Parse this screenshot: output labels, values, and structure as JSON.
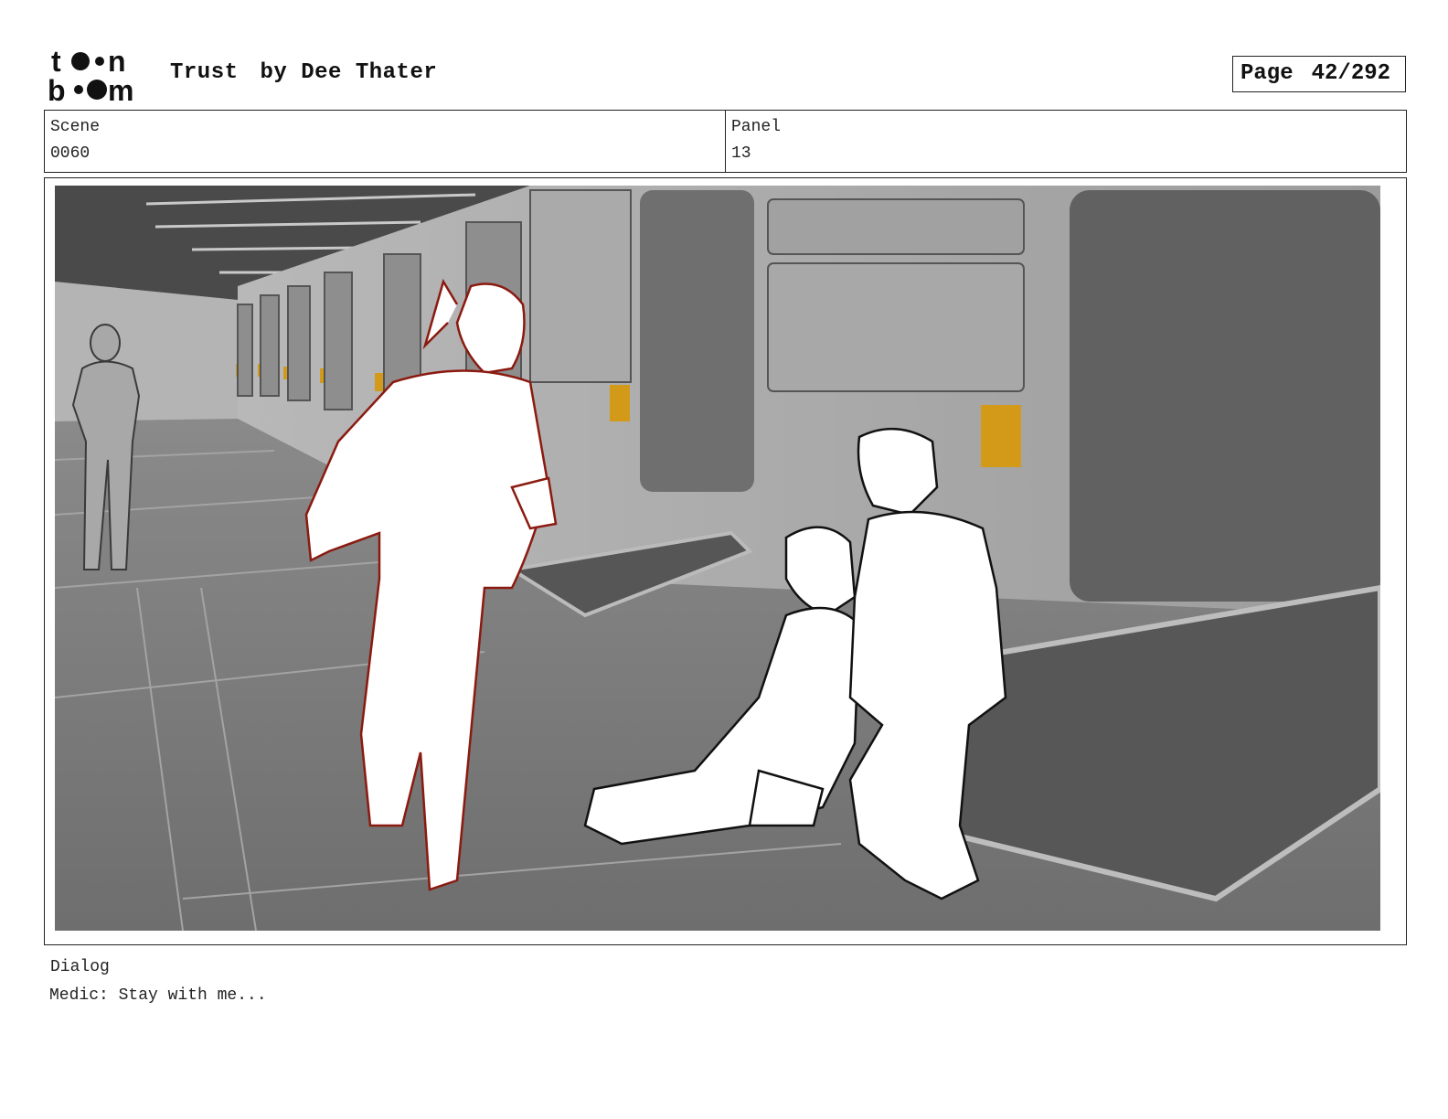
{
  "header": {
    "logo": {
      "text_top": "toon",
      "text_bottom": "boom",
      "icon": "toon-boom-logo"
    },
    "project_title": "Trust",
    "author": "by Dee Thater",
    "page_label": "Page",
    "page_value": "42/292"
  },
  "info": {
    "scene_label": "Scene",
    "scene_value": "0060",
    "panel_label": "Panel",
    "panel_value": "13"
  },
  "panel_image": {
    "icon": "storyboard-sketch-image",
    "colors": {
      "accent_red": "#8b1a10",
      "door_yellow": "#d39a1a",
      "wall": "#a7a7a7",
      "floor": "#7d7d7d"
    }
  },
  "dialog": {
    "label": "Dialog",
    "text": "Medic: Stay with me..."
  }
}
